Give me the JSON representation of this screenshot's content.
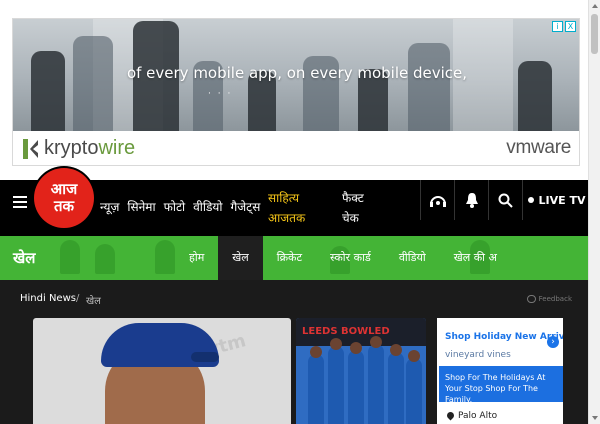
{
  "ad_banner": {
    "headline": "of every mobile app, on every mobile device,",
    "brand_left_a": "kr",
    "brand_left_b": "ypto",
    "brand_left_c": "wire",
    "brand_right": "vmware",
    "adchoices_info": "i",
    "adchoices_close": "X"
  },
  "header": {
    "logo_line1": "आज",
    "logo_line2": "तक",
    "nav": [
      "न्यूज़",
      "सिनेमा",
      "फोटो",
      "वीडियो",
      "गैजेट्स"
    ],
    "sahitya_line1": "साहित्य",
    "sahitya_line2": "आजतक",
    "fact_line1": "फैक्ट",
    "fact_line2": "चेक",
    "live_tv": "LIVE TV",
    "icons": [
      "podcast-icon",
      "bell-icon",
      "search-icon"
    ]
  },
  "section": {
    "title": "खेल",
    "tabs": [
      "होम",
      "खेल",
      "क्रिकेट",
      "स्कोर कार्ड",
      "वीडियो",
      "खेल की अ"
    ],
    "active_tab": "खेल"
  },
  "breadcrumb": {
    "home": "Hindi News",
    "separator": "/",
    "current": "खेल",
    "feedback": "Feedback"
  },
  "cards": {
    "card1_bg_text": "paytm",
    "card2_banner_text": "LEEDS BOWLED"
  },
  "side_ad": {
    "title": "Shop Holiday New Arrivals",
    "subtitle": "vineyard vines",
    "promo": "Shop For The Holidays At Your Stop Shop For The Family.",
    "location": "Palo Alto",
    "arrow": "›"
  },
  "colors": {
    "brand_red": "#e2231a",
    "section_green": "#44b436",
    "sahitya_yellow": "#f5c518"
  }
}
